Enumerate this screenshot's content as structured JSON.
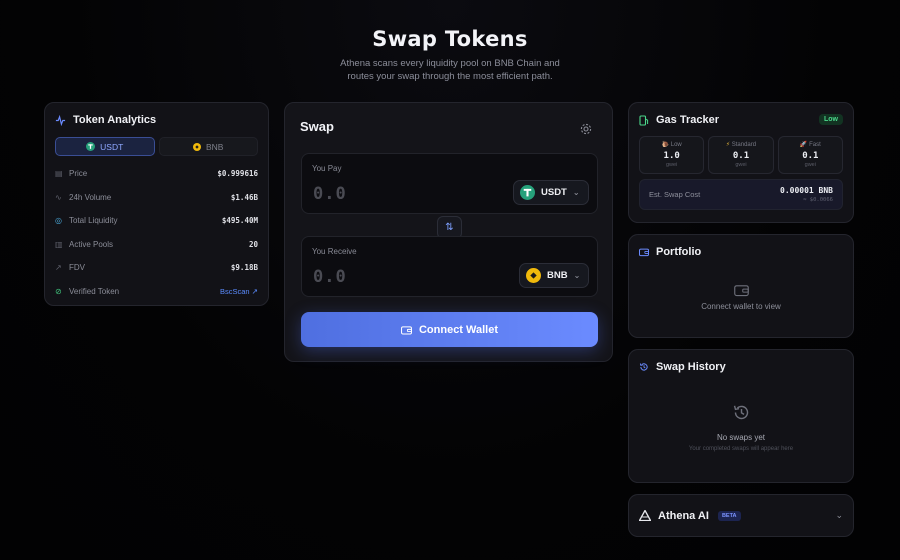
{
  "header": {
    "title": "Swap Tokens",
    "subtitle": "Athena scans every liquidity pool on BNB Chain and routes your swap through the most efficient path."
  },
  "analytics": {
    "title": "Token Analytics",
    "tabs": [
      {
        "label": "USDT",
        "active": true
      },
      {
        "label": "BNB",
        "active": false
      }
    ],
    "rows": [
      {
        "label": "Price",
        "value": "$0.999616"
      },
      {
        "label": "24h Volume",
        "value": "$1.46B"
      },
      {
        "label": "Total Liquidity",
        "value": "$495.40M"
      },
      {
        "label": "Active Pools",
        "value": "20"
      },
      {
        "label": "FDV",
        "value": "$9.18B"
      }
    ],
    "verified_label": "Verified Token",
    "explorer_link": "BscScan"
  },
  "swap": {
    "title": "Swap",
    "pay_label": "You Pay",
    "pay_amount": "0.0",
    "pay_token": "USDT",
    "receive_label": "You Receive",
    "receive_amount": "0.0",
    "receive_token": "BNB",
    "connect_label": "Connect Wallet"
  },
  "gas": {
    "title": "Gas Tracker",
    "status": "Low",
    "tiers": [
      {
        "label": "Low",
        "value": "1.0",
        "unit": "gwei"
      },
      {
        "label": "Standard",
        "value": "0.1",
        "unit": "gwei"
      },
      {
        "label": "Fast",
        "value": "0.1",
        "unit": "gwei"
      }
    ],
    "est_label": "Est. Swap Cost",
    "est_value": "0.00001 BNB",
    "est_usd": "≈ $0.0066"
  },
  "portfolio": {
    "title": "Portfolio",
    "empty_text": "Connect wallet to view"
  },
  "history": {
    "title": "Swap History",
    "empty_title": "No swaps yet",
    "empty_sub": "Your completed swaps will appear here"
  },
  "athena": {
    "title": "Athena AI",
    "badge": "BETA"
  },
  "colors": {
    "accent": "#5b7bf0",
    "usdt": "#26a17b",
    "bnb": "#f0b90b",
    "success": "#4bd88b"
  }
}
